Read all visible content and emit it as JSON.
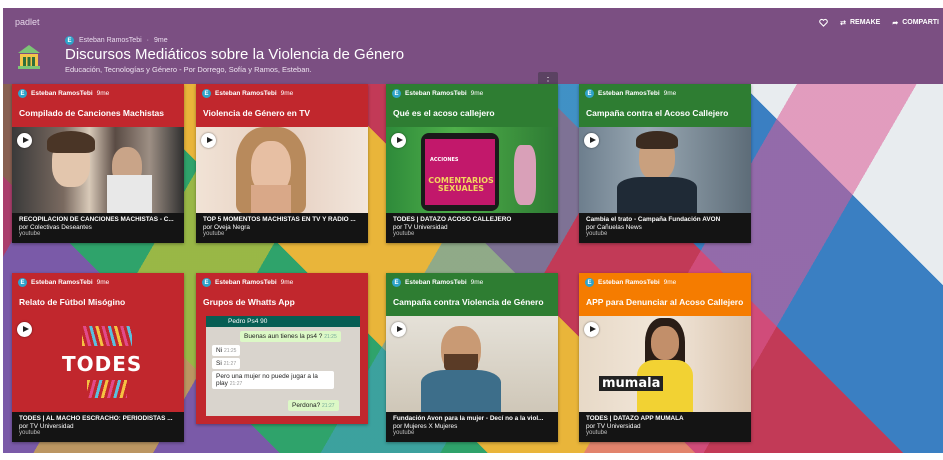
{
  "app": {
    "brand": "padlet"
  },
  "actions": {
    "remake": "REMAKE",
    "share": "COMPARTI"
  },
  "header": {
    "author_initial": "E",
    "author": "Esteban RamosTebi",
    "separator": "·",
    "time": "9me",
    "title": "Discursos Mediáticos sobre la Violencia de Género",
    "subtitle": "Educación, Tecnologías y Género - Por Dorrego, Sofía y Ramos, Esteban."
  },
  "more_button": "⋮",
  "cards": [
    {
      "color": "#c1272d",
      "author": "Esteban RamosTebi",
      "time": "9me",
      "title": "Compilado de Canciones Machistas",
      "foot_title": "RECOPILACIÓN DE CANCIONES MACHISTAS - C...",
      "foot_by": "por Colectivas Deseantes",
      "source": "youtube"
    },
    {
      "color": "#c1272d",
      "author": "Esteban RamosTebi",
      "time": "9me",
      "title": "Violencia de Género en TV",
      "foot_title": "TOP 5 MOMENTOS MACHISTAS EN TV Y RADIO ...",
      "foot_by": "por Oveja Negra",
      "source": "youtube"
    },
    {
      "color": "#2e7d32",
      "author": "Esteban RamosTebi",
      "time": "9me",
      "title": "Qué es el acoso callejero",
      "foot_title": "TODES | DATAZO ACOSO CALLEJERO",
      "foot_by": "por TV Universidad",
      "source": "youtube",
      "thumb_text": "COMENTARIOS SEXUALES",
      "thumb_small": "ACCIONES"
    },
    {
      "color": "#2e7d32",
      "author": "Esteban RamosTebi",
      "time": "9me",
      "title": "Campaña contra el Acoso Callejero",
      "foot_title": "Cambia el trato - Campaña Fundación AVON",
      "foot_by": "por Cañuelas News",
      "source": "youtube"
    },
    {
      "color": "#c1272d",
      "author": "Esteban RamosTebi",
      "time": "9me",
      "title": "Relato de Fútbol Misógino",
      "foot_title": "TODES | AL MACHO ESCRACHO: PERIODISTAS ...",
      "foot_by": "por TV Universidad",
      "source": "youtube",
      "thumb_text": "TODES"
    },
    {
      "color": "#c1272d",
      "author": "Esteban RamosTebi",
      "time": "9me",
      "title": "Grupos de Whatts App",
      "chat_header": "Pedro Ps4 90",
      "chat": [
        {
          "text": "Buenas aun tienes la ps4 ?",
          "time": "21:25",
          "side": "out"
        },
        {
          "text": "Ni",
          "time": "21:25",
          "side": "in"
        },
        {
          "text": "Si",
          "time": "21:27",
          "side": "in"
        },
        {
          "text": "Pero una mujer no puede jugar a la play",
          "time": "21:27",
          "side": "in"
        },
        {
          "text": "Perdona?",
          "time": "21:27",
          "side": "out"
        }
      ]
    },
    {
      "color": "#2e7d32",
      "author": "Esteban RamosTebi",
      "time": "9me",
      "title": "Campaña contra Violencia de Género",
      "foot_title": "Fundación Avon para la mujer - Decí no a la viol...",
      "foot_by": "por Mujeres X Mujeres",
      "source": "youtube"
    },
    {
      "color": "#f57c00",
      "author": "Esteban RamosTebi",
      "time": "9me",
      "title": "APP para Denunciar al Acoso Callejero",
      "foot_title": "TODES | DATAZO APP MUMALA",
      "foot_by": "por TV Universidad",
      "source": "youtube",
      "thumb_text": "mumala"
    }
  ],
  "colors": {
    "topbar": "#7b4f82",
    "red": "#c1272d",
    "green": "#2e7d32",
    "orange": "#f57c00"
  }
}
